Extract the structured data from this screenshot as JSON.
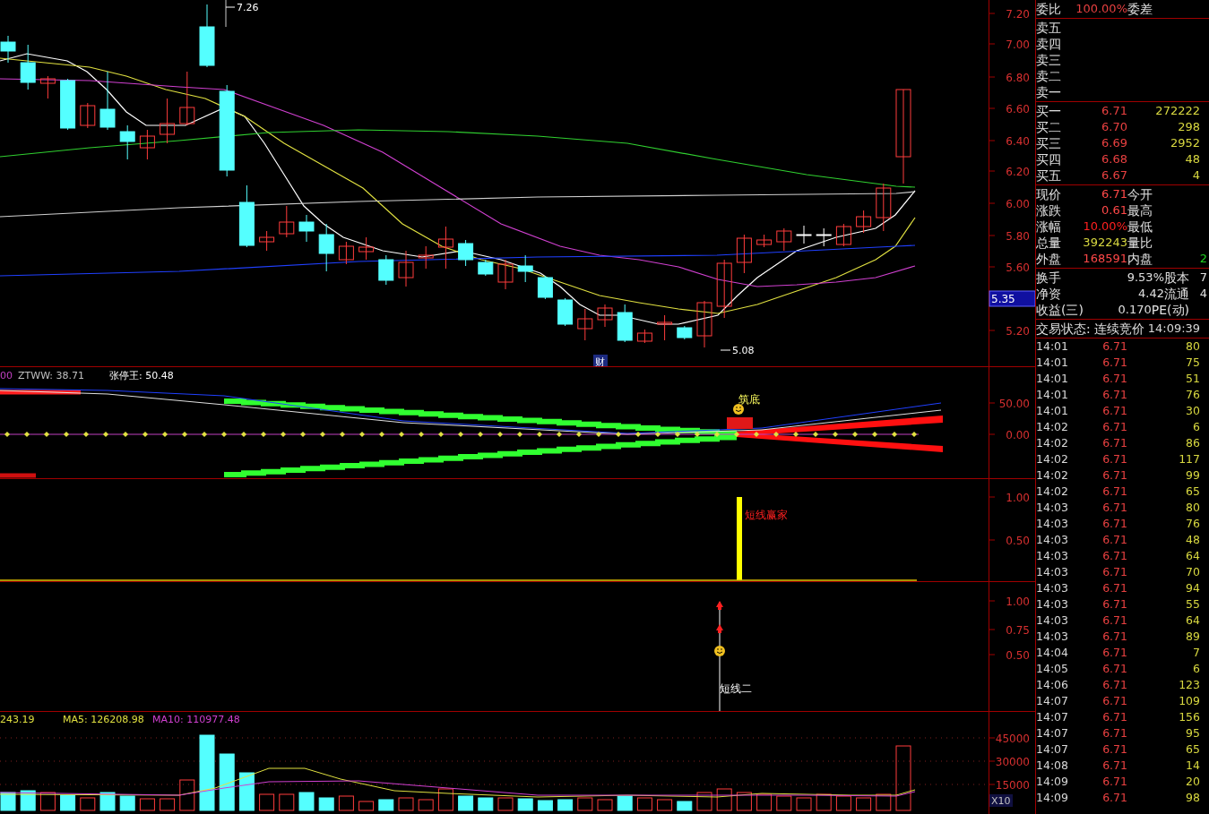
{
  "main_chart": {
    "price_axis": [
      "7.20",
      "7.00",
      "6.80",
      "6.60",
      "6.40",
      "6.20",
      "6.00",
      "5.80",
      "5.60",
      "5.20"
    ],
    "high_marker": "7.26",
    "low_marker": "5.08",
    "event_badge": "财",
    "current_price_tag": "5.35"
  },
  "indicator_1": {
    "legend": [
      {
        "text": "00",
        "color": "#c040c0"
      },
      {
        "text": "ZTWW: 38.71",
        "color": "#c0c0c0"
      },
      {
        "text": "张停王: 50.48",
        "color": "#ffffff"
      }
    ],
    "axis": [
      "50.00",
      "0.00"
    ],
    "signal": "筑底"
  },
  "indicator_2": {
    "axis": [
      "1.00",
      "0.50"
    ],
    "signal": "短线赢家"
  },
  "indicator_3": {
    "axis": [
      "1.00",
      "0.75",
      "0.50"
    ],
    "signal": "短线二"
  },
  "volume": {
    "legend": [
      {
        "text": "243.19",
        "color": "#e0e040"
      },
      {
        "text": "MA5: 126208.98",
        "color": "#e0e040"
      },
      {
        "text": "MA10: 110977.48",
        "color": "#d040d0"
      }
    ],
    "axis": [
      "45000",
      "30000",
      "15000"
    ],
    "scale": "X10"
  },
  "quote": {
    "ratio_row": {
      "label": "委比",
      "value": "100.00%",
      "label_2": "委差"
    },
    "asks": [
      {
        "label": "卖五"
      },
      {
        "label": "卖四"
      },
      {
        "label": "卖三"
      },
      {
        "label": "卖二"
      },
      {
        "label": "卖一"
      }
    ],
    "bids": [
      {
        "label": "买一",
        "price": "6.71",
        "volume": "272222"
      },
      {
        "label": "买二",
        "price": "6.70",
        "volume": "298"
      },
      {
        "label": "买三",
        "price": "6.69",
        "volume": "2952"
      },
      {
        "label": "买四",
        "price": "6.68",
        "volume": "48"
      },
      {
        "label": "买五",
        "price": "6.67",
        "volume": "4"
      }
    ],
    "stats": [
      {
        "label": "现价",
        "value": "6.71",
        "color": "#ff4848",
        "label_2": "今开"
      },
      {
        "label": "涨跌",
        "value": "0.61",
        "color": "#ff4848",
        "label_2": "最高"
      },
      {
        "label": "涨幅",
        "value": "10.00%",
        "color": "#ff2020",
        "label_2": "最低"
      },
      {
        "label": "总量",
        "value": "392243",
        "color": "#d8d840",
        "label_2": "量比"
      },
      {
        "label": "外盘",
        "value": "168591",
        "color": "#ff4848",
        "label_2": "内盘",
        "value_2": {
          "text": "2",
          "color": "#20d020"
        }
      }
    ],
    "stats_2": [
      {
        "label": "换手",
        "value": "9.53%",
        "label_2": "股本",
        "value_2": "7"
      },
      {
        "label": "净资",
        "value": "4.42",
        "label_2": "流通",
        "value_2": "4"
      },
      {
        "label": "收益(三)",
        "value": "0.170",
        "label_2": "PE(动)"
      }
    ],
    "status": {
      "label": "交易状态:",
      "value": "连续竞价",
      "time": "14:09:39"
    },
    "ticks": [
      {
        "time": "14:01",
        "price": "6.71",
        "volume": "80"
      },
      {
        "time": "14:01",
        "price": "6.71",
        "volume": "75"
      },
      {
        "time": "14:01",
        "price": "6.71",
        "volume": "51"
      },
      {
        "time": "14:01",
        "price": "6.71",
        "volume": "76"
      },
      {
        "time": "14:01",
        "price": "6.71",
        "volume": "30"
      },
      {
        "time": "14:02",
        "price": "6.71",
        "volume": "6"
      },
      {
        "time": "14:02",
        "price": "6.71",
        "volume": "86"
      },
      {
        "time": "14:02",
        "price": "6.71",
        "volume": "117"
      },
      {
        "time": "14:02",
        "price": "6.71",
        "volume": "99"
      },
      {
        "time": "14:02",
        "price": "6.71",
        "volume": "65"
      },
      {
        "time": "14:03",
        "price": "6.71",
        "volume": "80"
      },
      {
        "time": "14:03",
        "price": "6.71",
        "volume": "76"
      },
      {
        "time": "14:03",
        "price": "6.71",
        "volume": "48"
      },
      {
        "time": "14:03",
        "price": "6.71",
        "volume": "64"
      },
      {
        "time": "14:03",
        "price": "6.71",
        "volume": "70"
      },
      {
        "time": "14:03",
        "price": "6.71",
        "volume": "94"
      },
      {
        "time": "14:03",
        "price": "6.71",
        "volume": "55"
      },
      {
        "time": "14:03",
        "price": "6.71",
        "volume": "64"
      },
      {
        "time": "14:03",
        "price": "6.71",
        "volume": "89"
      },
      {
        "time": "14:04",
        "price": "6.71",
        "volume": "7"
      },
      {
        "time": "14:05",
        "price": "6.71",
        "volume": "6"
      },
      {
        "time": "14:06",
        "price": "6.71",
        "volume": "123"
      },
      {
        "time": "14:07",
        "price": "6.71",
        "volume": "109"
      },
      {
        "time": "14:07",
        "price": "6.71",
        "volume": "156"
      },
      {
        "time": "14:07",
        "price": "6.71",
        "volume": "95"
      },
      {
        "time": "14:07",
        "price": "6.71",
        "volume": "65"
      },
      {
        "time": "14:08",
        "price": "6.71",
        "volume": "14"
      },
      {
        "time": "14:09",
        "price": "6.71",
        "volume": "20"
      },
      {
        "time": "14:09",
        "price": "6.71",
        "volume": "98"
      }
    ]
  }
}
